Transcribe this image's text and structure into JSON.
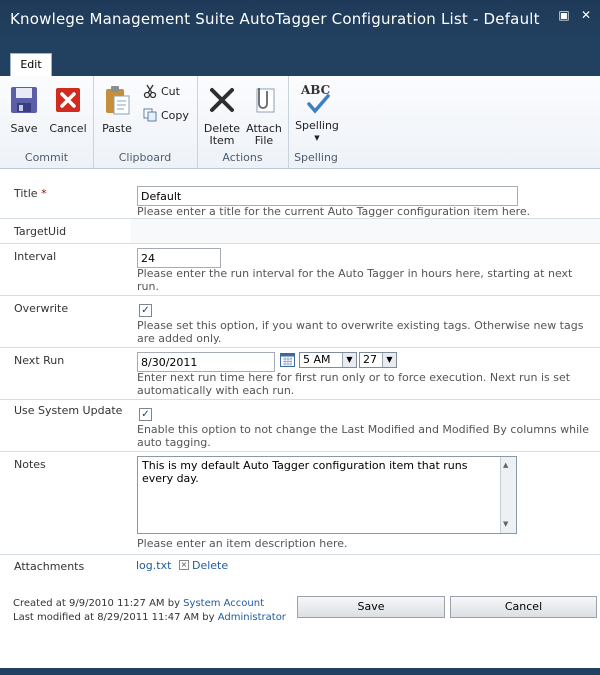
{
  "window": {
    "title": "Knowlege Management Suite AutoTagger Configuration List - Default"
  },
  "tabs": [
    {
      "label": "Edit"
    }
  ],
  "ribbon": {
    "commit": {
      "group_label": "Commit",
      "save": "Save",
      "cancel": "Cancel"
    },
    "clipboard": {
      "group_label": "Clipboard",
      "paste": "Paste",
      "cut": "Cut",
      "copy": "Copy"
    },
    "actions": {
      "group_label": "Actions",
      "delete_line1": "Delete",
      "delete_line2": "Item",
      "attach_line1": "Attach",
      "attach_line2": "File"
    },
    "spelling": {
      "group_label": "Spelling",
      "label": "Spelling",
      "icon_text": "ABC"
    }
  },
  "form": {
    "title": {
      "label": "Title",
      "required_mark": "*",
      "value": "Default",
      "hint": "Please enter a title for the current Auto Tagger configuration item here."
    },
    "targetuid": {
      "label": "TargetUid"
    },
    "interval": {
      "label": "Interval",
      "value": "24",
      "hint_line1": "Please enter the run interval for the Auto Tagger in hours here, starting at next",
      "hint_line2": "run."
    },
    "overwrite": {
      "label": "Overwrite",
      "checked": true,
      "hint_line1": "Please set this option, if you want to overwrite existing tags. Otherwise new tags",
      "hint_line2": "are added only."
    },
    "nextrun": {
      "label": "Next Run",
      "date": "8/30/2011",
      "hour": "5 AM",
      "minute": "27",
      "hint_line1": "Enter next run time here for first run only or to force execution. Next run is set",
      "hint_line2": "automatically with each run."
    },
    "systemupdate": {
      "label": "Use System Update",
      "checked": true,
      "hint_line1": "Enable this option to not change the Last Modified and Modified By columns while",
      "hint_line2": "auto tagging."
    },
    "notes": {
      "label": "Notes",
      "value_line1": "This is my default Auto Tagger configuration item that runs",
      "value_line2": "every day.",
      "hint": "Please enter an item description here."
    },
    "attachments": {
      "label": "Attachments",
      "file": "log.txt",
      "delete": "Delete"
    }
  },
  "footer": {
    "created_prefix": "Created at 9/9/2010 11:27 AM  by",
    "created_by": "System Account",
    "modified_prefix": "Last modified at 8/29/2011 11:47 AM  by",
    "modified_by": "Administrator",
    "save": "Save",
    "cancel": "Cancel"
  },
  "colors": {
    "titlebar": "#22405f",
    "link": "#1f5b9e",
    "required": "#b00000"
  }
}
